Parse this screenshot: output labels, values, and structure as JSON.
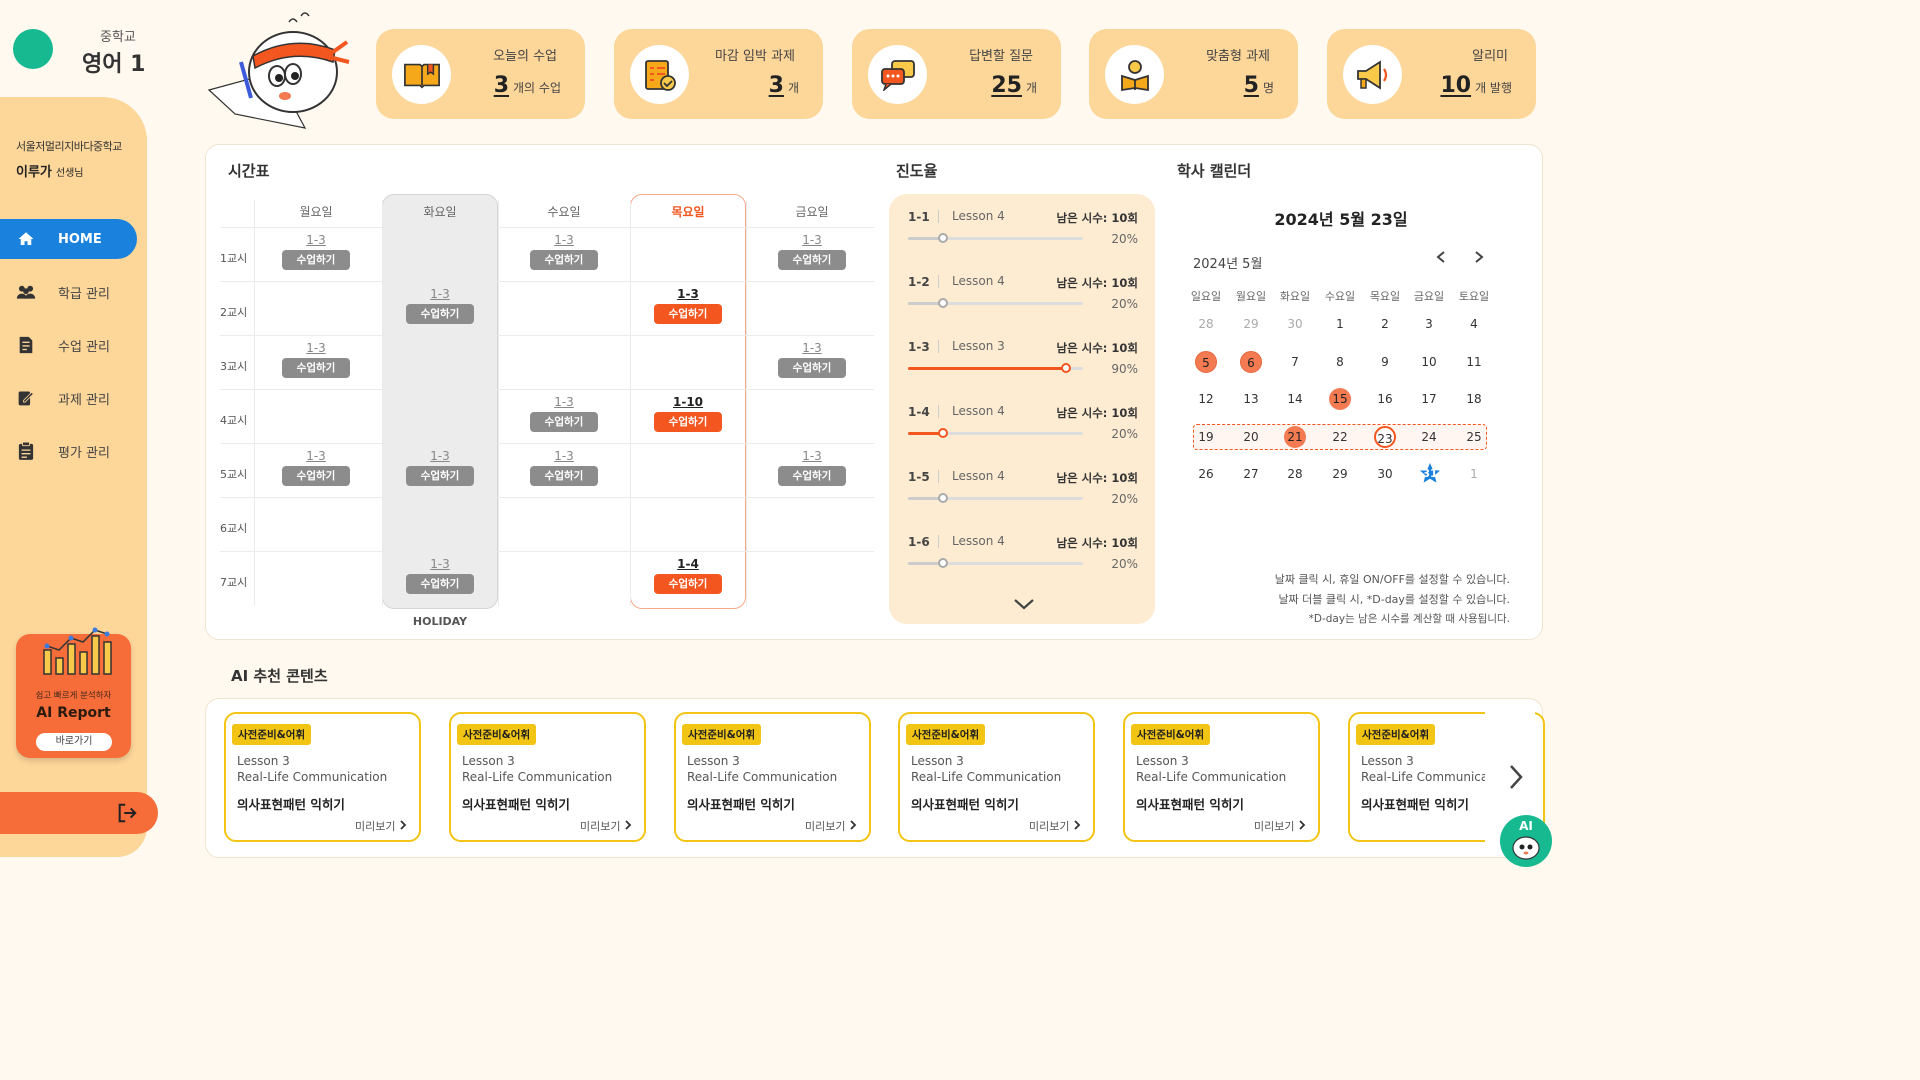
{
  "header": {
    "school_level": "중학교",
    "subject": "영어 1"
  },
  "profile": {
    "school_name": "서울저멀리지바다중학교",
    "teacher_name": "이루가",
    "teacher_title": "선생님"
  },
  "nav": [
    {
      "label": "HOME",
      "icon": "home-icon"
    },
    {
      "label": "학급 관리",
      "icon": "users-icon"
    },
    {
      "label": "수업 관리",
      "icon": "book-icon"
    },
    {
      "label": "과제 관리",
      "icon": "edit-icon"
    },
    {
      "label": "평가 관리",
      "icon": "clipboard-icon"
    }
  ],
  "ai_report": {
    "subtitle": "쉽고 빠르게 분석하자",
    "title": "AI Report",
    "button": "바로가기"
  },
  "stats": [
    {
      "label": "오늘의 수업",
      "value": "3",
      "unit": "개의 수업",
      "icon": "book-open-icon"
    },
    {
      "label": "마감 임박 과제",
      "value": "3",
      "unit": "개",
      "icon": "checklist-icon"
    },
    {
      "label": "답변할 질문",
      "value": "25",
      "unit": "개",
      "icon": "chat-icon"
    },
    {
      "label": "맞춤형 과제",
      "value": "5",
      "unit": "명",
      "icon": "student-reading-icon"
    },
    {
      "label": "알리미",
      "value": "10",
      "unit": "개 발행",
      "icon": "megaphone-icon"
    }
  ],
  "timetable": {
    "title": "시간표",
    "days": [
      "월요일",
      "화요일",
      "수요일",
      "목요일",
      "금요일"
    ],
    "periods": [
      "1교시",
      "2교시",
      "3교시",
      "4교시",
      "5교시",
      "6교시",
      "7교시"
    ],
    "holiday_label": "HOLIDAY",
    "button_label": "수업하기",
    "cells": [
      [
        "1-3",
        "",
        "1-3",
        "",
        "1-3"
      ],
      [
        "",
        "1-3",
        "",
        "1-3",
        ""
      ],
      [
        "1-3",
        "",
        "",
        "",
        "1-3"
      ],
      [
        "",
        "",
        "1-3",
        "1-10",
        ""
      ],
      [
        "1-3",
        "1-3",
        "1-3",
        "",
        "1-3"
      ],
      [
        "",
        "",
        "",
        "",
        ""
      ],
      [
        "",
        "1-3",
        "",
        "1-4",
        ""
      ]
    ]
  },
  "progress": {
    "title": "진도율",
    "remaining_label": "남은 시수: 10회",
    "rows": [
      {
        "cls": "1-1",
        "lesson": "Lesson 4",
        "percent": 20
      },
      {
        "cls": "1-2",
        "lesson": "Lesson 4",
        "percent": 20
      },
      {
        "cls": "1-3",
        "lesson": "Lesson 3",
        "percent": 90
      },
      {
        "cls": "1-4",
        "lesson": "Lesson 4",
        "percent": 20
      },
      {
        "cls": "1-5",
        "lesson": "Lesson 4",
        "percent": 20
      },
      {
        "cls": "1-6",
        "lesson": "Lesson 4",
        "percent": 20
      }
    ]
  },
  "calendar": {
    "title": "학사 캘린더",
    "date_title": "2024년 5월 23일",
    "month": "2024년 5월",
    "weekdays": [
      "일요일",
      "월요일",
      "화요일",
      "수요일",
      "목요일",
      "금요일",
      "토요일"
    ],
    "weeks": [
      [
        "28",
        "29",
        "30",
        "1",
        "2",
        "3",
        "4"
      ],
      [
        "5",
        "6",
        "7",
        "8",
        "9",
        "10",
        "11"
      ],
      [
        "12",
        "13",
        "14",
        "15",
        "16",
        "17",
        "18"
      ],
      [
        "19",
        "20",
        "21",
        "22",
        "23",
        "24",
        "25"
      ],
      [
        "26",
        "27",
        "28",
        "29",
        "30",
        "31",
        "1"
      ]
    ],
    "notes": [
      "날짜 클릭 시, 휴일 ON/OFF를 설정할 수 있습니다.",
      "날짜 더블 클릭 시, *D-day를 설정할 수 있습니다.",
      "*D-day는 남은 시수를 계산할 때 사용됩니다."
    ]
  },
  "ai_contents": {
    "title": "AI 추천 콘텐츠",
    "cards": [
      {
        "tag": "사전준비&어휘",
        "lesson": "Lesson 3",
        "topic": "Real-Life Communication",
        "name": "의사표현패턴 익히기",
        "preview": "미리보기"
      },
      {
        "tag": "사전준비&어휘",
        "lesson": "Lesson 3",
        "topic": "Real-Life Communication",
        "name": "의사표현패턴 익히기",
        "preview": "미리보기"
      },
      {
        "tag": "사전준비&어휘",
        "lesson": "Lesson 3",
        "topic": "Real-Life Communication",
        "name": "의사표현패턴 익히기",
        "preview": "미리보기"
      },
      {
        "tag": "사전준비&어휘",
        "lesson": "Lesson 3",
        "topic": "Real-Life Communication",
        "name": "의사표현패턴 익히기",
        "preview": "미리보기"
      },
      {
        "tag": "사전준비&어휘",
        "lesson": "Lesson 3",
        "topic": "Real-Life Communication",
        "name": "의사표현패턴 익히기",
        "preview": "미리보기"
      },
      {
        "tag": "사전준비&어휘",
        "lesson": "Lesson 3",
        "topic": "Real-Life Communication",
        "name": "의사표현패턴 익히기",
        "preview": "미리"
      }
    ]
  },
  "ai_bot_label": "AI",
  "colors": {
    "accent": "#f4561f",
    "primary_blue": "#1a82dc",
    "sidebar": "#fdd69a",
    "tag_yellow": "#f2c514",
    "brand_green": "#17b991"
  }
}
